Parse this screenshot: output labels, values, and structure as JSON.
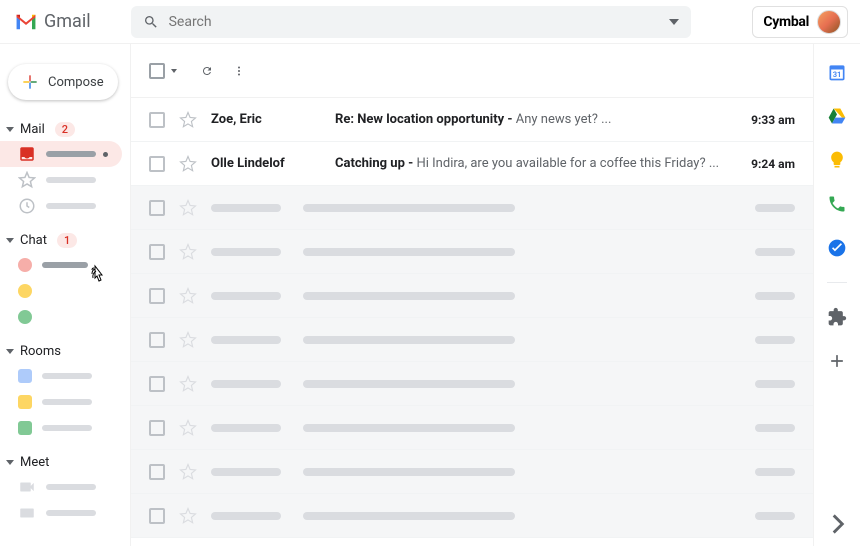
{
  "header": {
    "app_name": "Gmail",
    "search_placeholder": "Search",
    "org_name": "Cymbal"
  },
  "compose_label": "Compose",
  "sidebar": {
    "mail": {
      "label": "Mail",
      "badge": "2"
    },
    "chat": {
      "label": "Chat",
      "badge": "1"
    },
    "rooms": {
      "label": "Rooms"
    },
    "meet": {
      "label": "Meet"
    }
  },
  "emails": [
    {
      "sender": "Zoe, Eric",
      "subject": "Re: New location opportunity - ",
      "preview": "Any news yet? ...",
      "time": "9:33 am",
      "unread": true
    },
    {
      "sender": "Olle Lindelof",
      "subject": "Catching up - ",
      "preview": "Hi Indira, are you available for a coffee this Friday? ...",
      "time": "9:24 am",
      "unread": true
    }
  ]
}
